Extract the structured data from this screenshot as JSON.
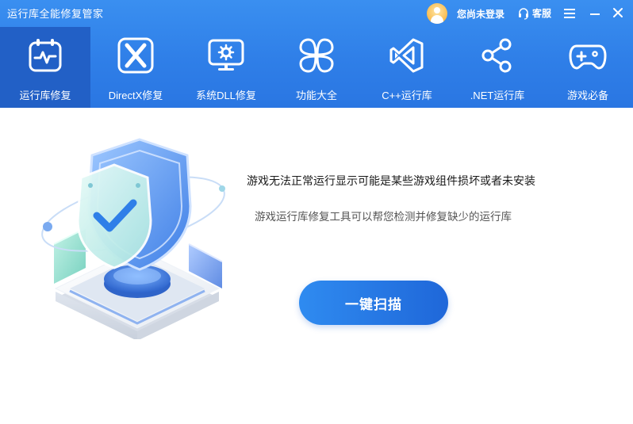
{
  "app": {
    "title": "运行库全能修复管家"
  },
  "titlebar": {
    "login_text": "您尚未登录",
    "service_label": "客服",
    "icons": [
      "avatar",
      "headset-icon",
      "menu-icon",
      "minimize-icon",
      "close-icon"
    ]
  },
  "tabs": [
    {
      "label": "运行库修复",
      "icon": "calendar-pulse-icon",
      "active": true
    },
    {
      "label": "DirectX修复",
      "icon": "directx-icon",
      "active": false
    },
    {
      "label": "系统DLL修复",
      "icon": "monitor-gear-icon",
      "active": false
    },
    {
      "label": "功能大全",
      "icon": "clover-icon",
      "active": false
    },
    {
      "label": "C++运行库",
      "icon": "visual-studio-icon",
      "active": false
    },
    {
      "label": ".NET运行库",
      "icon": "share-icon",
      "active": false
    },
    {
      "label": "游戏必备",
      "icon": "gamepad-icon",
      "active": false
    }
  ],
  "main": {
    "headline": "游戏无法正常运行显示可能是某些游戏组件损坏或者未安装",
    "subline": "游戏运行库修复工具可以帮您检测并修复缺少的运行库",
    "scan_button": "一键扫描"
  },
  "colors": {
    "header": "#2f7fe8",
    "active_tab": "#2260c6",
    "button": "#1f67d9"
  }
}
